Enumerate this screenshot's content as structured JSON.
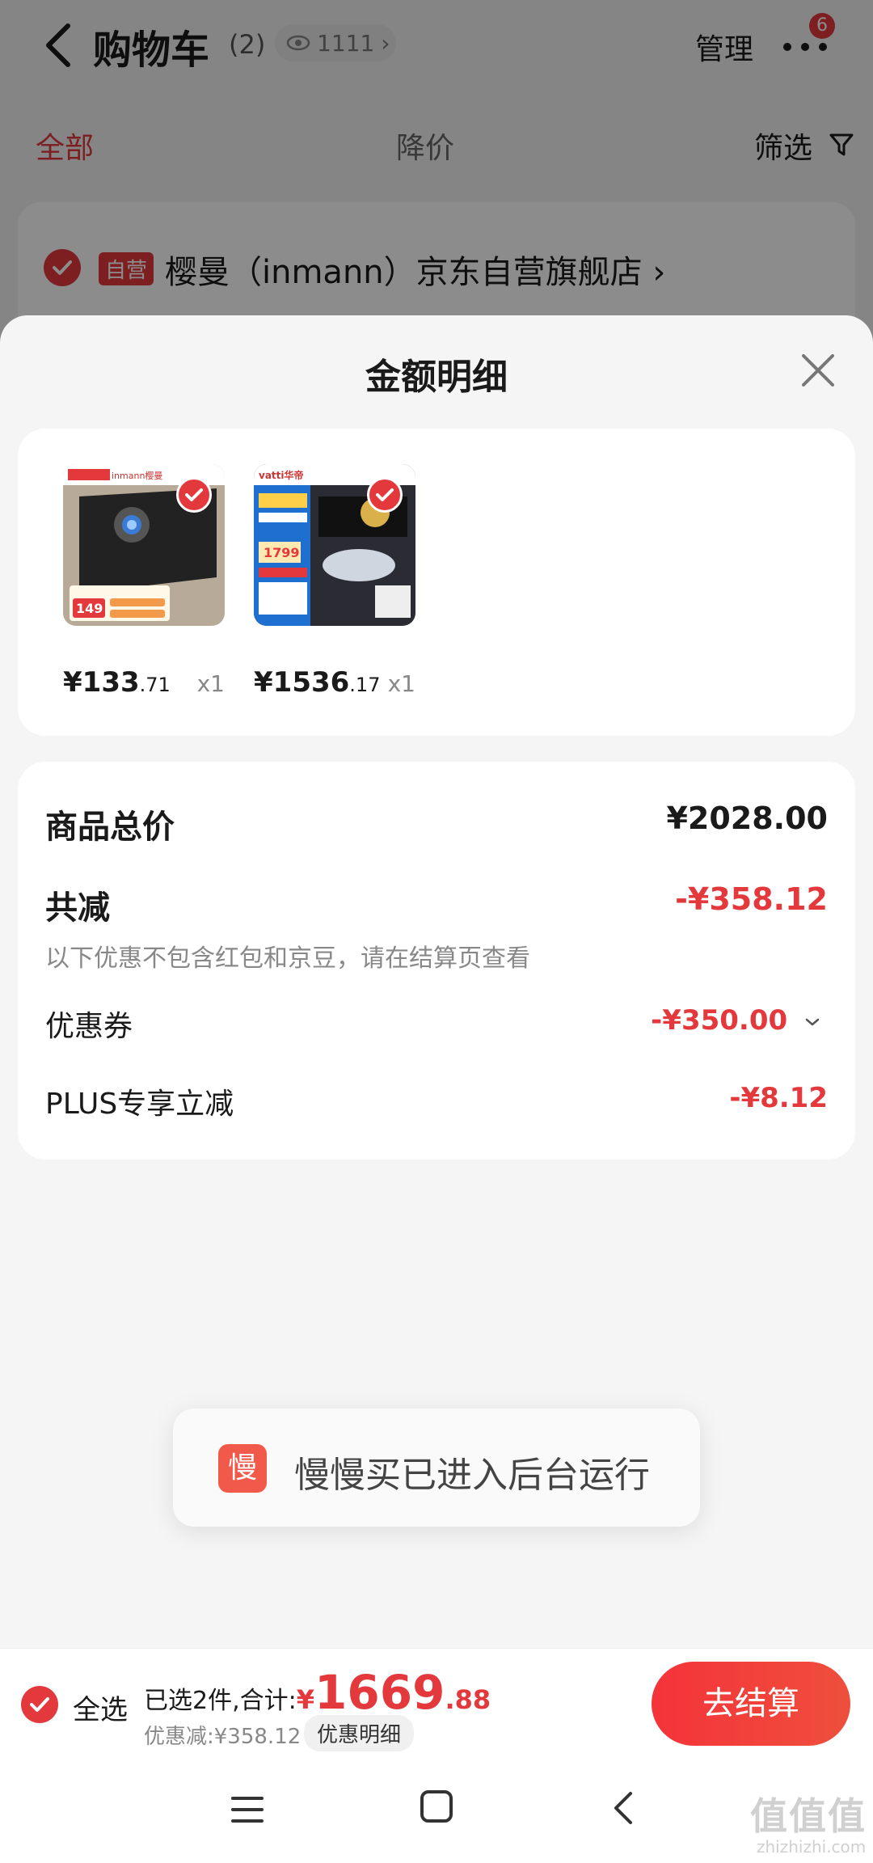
{
  "header": {
    "title": "购物车",
    "count": "(2)",
    "watch_count": "1111",
    "manage_label": "管理",
    "badge": "6"
  },
  "tabs": {
    "all": "全部",
    "price_drop": "降价",
    "filter": "筛选"
  },
  "store": {
    "self_tag": "自营",
    "name": "樱曼（inmann）京东自营旗舰店 ›"
  },
  "sheet": {
    "title": "金额明细",
    "products": [
      {
        "brand": "inmann樱曼",
        "img_price": "149",
        "price_int": "¥133",
        "price_dec": ".71",
        "qty": "x1"
      },
      {
        "brand": "vatti华帝",
        "img_price": "1799",
        "price_int": "¥1536",
        "price_dec": ".17",
        "qty": "x1"
      }
    ],
    "summary": {
      "total_label": "商品总价",
      "total_value": "¥2028.00",
      "discount_label": "共减",
      "discount_value": "-¥358.12",
      "discount_note": "以下优惠不包含红包和京豆，请在结算页查看",
      "coupon_label": "优惠券",
      "coupon_value": "-¥350.00",
      "plus_label": "PLUS专享立减",
      "plus_value": "-¥8.12"
    }
  },
  "toast": {
    "logo": "慢",
    "text": "慢慢买已进入后台运行"
  },
  "checkout": {
    "select_all": "全选",
    "selected_text": "已选2件,合计:",
    "currency": "¥",
    "total_int": "1669",
    "total_dec": ".88",
    "discount_text": "优惠减:¥358.12",
    "detail_label": "优惠明细",
    "button_label": "去结算"
  },
  "watermark": {
    "main": "值值值",
    "sub": "zhizhizhi.com"
  },
  "colors": {
    "accent": "#e4393c",
    "background": "#f5f5f5"
  }
}
